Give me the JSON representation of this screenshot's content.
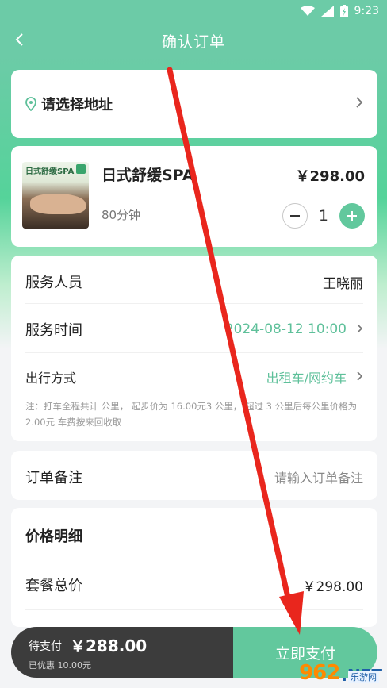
{
  "colors": {
    "accent_green": "#62c89d",
    "header_green": "#6ccba7",
    "dark_bar": "#3c3c3c",
    "annotation_red": "#e9261d"
  },
  "status_bar": {
    "time": "9:23",
    "icons": [
      "wifi-icon",
      "signal-icon",
      "battery-icon"
    ]
  },
  "nav": {
    "back_icon": "chevron-left-icon",
    "title": "确认订单"
  },
  "address": {
    "icon": "location-pin-icon",
    "text": "请选择地址"
  },
  "product": {
    "thumbnail_text": "日式舒缓SPA",
    "name": "日式舒缓SPA",
    "price": "￥298.00",
    "duration": "80分钟",
    "quantity": "1",
    "minus_icon": "minus-icon",
    "plus_icon": "plus-icon"
  },
  "service": {
    "staff_label": "服务人员",
    "staff_value": "王晓丽",
    "time_label": "服务时间",
    "time_value": "2024-08-12 10:00",
    "travel_label": "出行方式",
    "travel_value": "出租车/网约车",
    "note": "注：打车全程共计 公里， 起步价为 16.00元3 公里， 超过 3 公里后每公里价格为 2.00元 车费按来回收取"
  },
  "remark": {
    "label": "订单备注",
    "placeholder": "请输入订单备注"
  },
  "price_detail": {
    "title": "价格明细",
    "total_label": "套餐总价",
    "total_value": "￥298.00"
  },
  "payment": {
    "pending_label": "待支付",
    "amount": "￥288.00",
    "discount": "已优惠 10.00元",
    "pay_button": "立即支付"
  },
  "watermark": {
    "brand": "962",
    "suffix": ".NET",
    "sub": "乐游网"
  }
}
